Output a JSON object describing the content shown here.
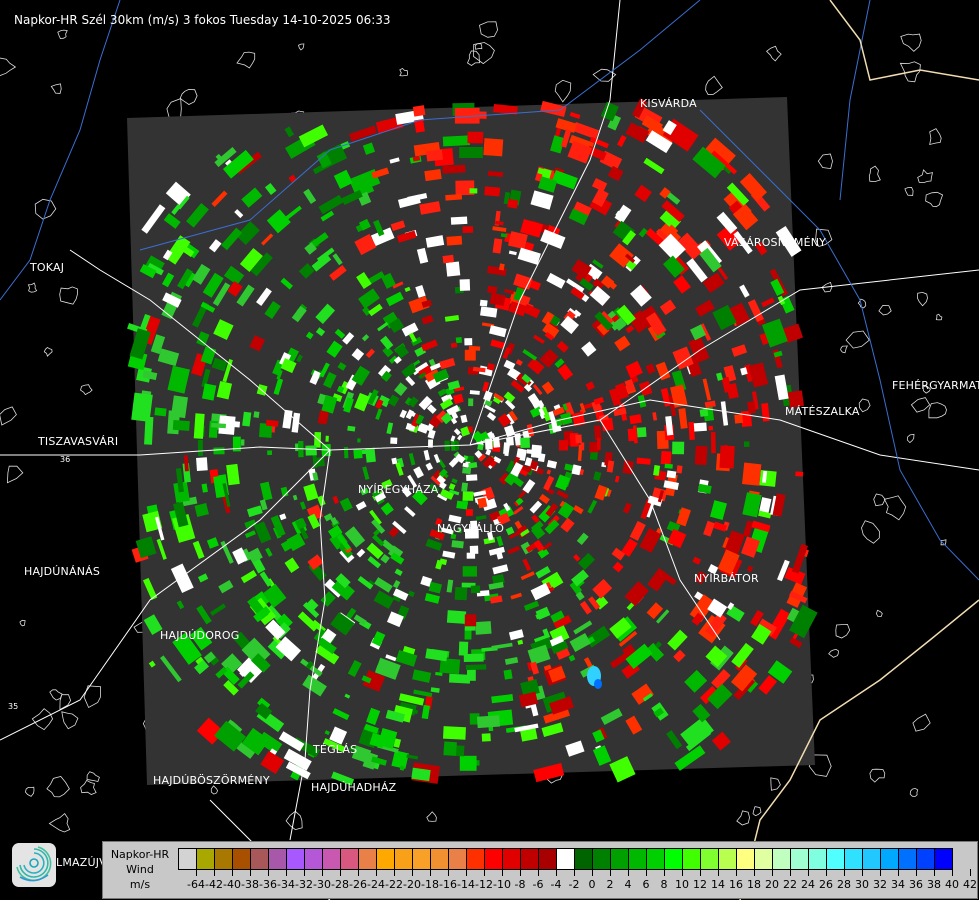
{
  "title": "Napkor-HR Szél 30km (m/s) 3 fokos Tuesday 14-10-2025 06:33",
  "towns": [
    {
      "name": "KISVÁRDA"
    },
    {
      "name": "VÁSÁROSNAMÉNY"
    },
    {
      "name": "TOKAJ"
    },
    {
      "name": "FEHÉRGYARMAT"
    },
    {
      "name": "MÁTÉSZALKA"
    },
    {
      "name": "TISZAVASVÁRI"
    },
    {
      "name": "NYÍREGYHÁZA"
    },
    {
      "name": "NAGYKÁLLÓ"
    },
    {
      "name": "NYÍRBÁTOR"
    },
    {
      "name": "HAJDÚNÁNÁS"
    },
    {
      "name": "HAJDÚDOROG"
    },
    {
      "name": "TÉGLÁS"
    },
    {
      "name": "HAJDÚBÖSZÖRMÉNY"
    },
    {
      "name": "HAJDÚHADHÁZ"
    },
    {
      "name": "LMAZÚJVÁROS"
    }
  ],
  "road_numbers": [
    "36",
    "35"
  ],
  "logo": {
    "icon": "swirl-logo-icon"
  },
  "legend": {
    "line1": "Napkor-HR",
    "line2": "Wind",
    "line3": "m/s",
    "labels": [
      "-64",
      "-42",
      "-40",
      "-38",
      "-36",
      "-34",
      "-32",
      "-30",
      "-28",
      "-26",
      "-24",
      "-22",
      "-20",
      "-18",
      "-16",
      "-14",
      "-12",
      "-10",
      "-8",
      "-6",
      "-4",
      "-2",
      "0",
      "2",
      "4",
      "6",
      "8",
      "10",
      "12",
      "14",
      "16",
      "18",
      "20",
      "22",
      "24",
      "26",
      "28",
      "30",
      "32",
      "34",
      "36",
      "38",
      "40",
      "42"
    ],
    "colors": [
      "#d3d3d3",
      "#a8a800",
      "#a87800",
      "#a85000",
      "#a85858",
      "#a858a8",
      "#a858ff",
      "#b458d8",
      "#c858b0",
      "#d85880",
      "#e88048",
      "#ffa800",
      "#f8a018",
      "#f8a028",
      "#f09030",
      "#e88048",
      "#ff3000",
      "#ff0000",
      "#e00000",
      "#c00000",
      "#a80000",
      "#ffffff",
      "#006400",
      "#008000",
      "#00a000",
      "#00b800",
      "#00d000",
      "#00ff00",
      "#40ff00",
      "#80ff30",
      "#b8ff50",
      "#ffff80",
      "#e0ffa0",
      "#c0ffc0",
      "#a0ffd0",
      "#80ffe0",
      "#50ffff",
      "#30e0ff",
      "#20c8ff",
      "#00a8ff",
      "#0070ff",
      "#0040ff",
      "#0000ff"
    ]
  }
}
